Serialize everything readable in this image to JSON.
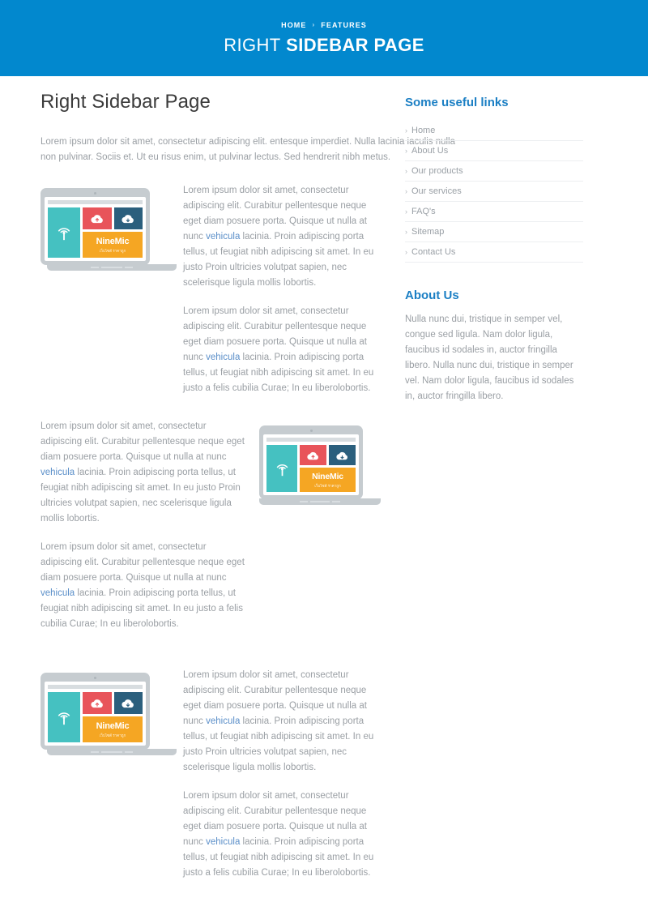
{
  "header": {
    "breadcrumb": {
      "home": "HOME",
      "separator": "›",
      "current": "FEATURES"
    },
    "title_light": "RIGHT",
    "title_bold": "SIDEBAR PAGE",
    "background_color": "#0288ce"
  },
  "main": {
    "page_title": "Right Sidebar Page",
    "intro": "Lorem ipsum dolor sit amet, consectetur adipiscing elit. entesque imperdiet. Nulla lacinia iaculis nulla non pulvinar. Sociis et. Ut eu risus enim, ut pulvinar lectus. Sed hendrerit nibh metus.",
    "para_long_a": "Lorem ipsum dolor sit amet, consectetur adipiscing elit. Curabitur pellentesque neque eget diam posuere porta. Quisque ut nulla at nunc ",
    "para_long_b": " lacinia. Proin adipiscing porta tellus, ut feugiat nibh adipiscing sit amet. In eu justo Proin ultricies volutpat sapien, nec scelerisque ligula mollis lobortis.",
    "para_short_a": "Lorem ipsum dolor sit amet, consectetur adipiscing elit. Curabitur pellentesque neque eget diam posuere porta. Quisque ut nulla at nunc ",
    "para_short_b": " lacinia. Proin adipiscing porta tellus, ut feugiat nibh adipiscing sit amet. In eu justo a felis cubilia Curae; In eu liberolobortis.",
    "link_text": "vehicula",
    "link_color": "#5b8fc9"
  },
  "laptop": {
    "brand": "NineMic",
    "brand_sub": "เว็บไซต์ ราคาถูก",
    "colors": {
      "teal": "#45c1c1",
      "red": "#e8545a",
      "navy": "#2b5f7d",
      "orange": "#f5a623",
      "frame": "#c6ccd0"
    },
    "icons": {
      "left": "wifi-broadcast-icon",
      "tile2": "cloud-upload-icon",
      "tile3": "cloud-download-icon"
    }
  },
  "sidebar": {
    "links_heading": "Some useful links",
    "links": [
      {
        "label": "Home"
      },
      {
        "label": "About Us"
      },
      {
        "label": "Our products"
      },
      {
        "label": "Our services"
      },
      {
        "label": "FAQ's"
      },
      {
        "label": "Sitemap"
      },
      {
        "label": "Contact Us"
      }
    ],
    "chevron": "›",
    "about_heading": "About Us",
    "about_text": "Nulla nunc dui, tristique in semper vel, congue sed ligula. Nam dolor ligula, faucibus id sodales in, auctor fringilla libero. Nulla nunc dui, tristique in semper vel. Nam dolor ligula, faucibus id sodales in, auctor fringilla libero.",
    "heading_color": "#1b7fc4"
  }
}
